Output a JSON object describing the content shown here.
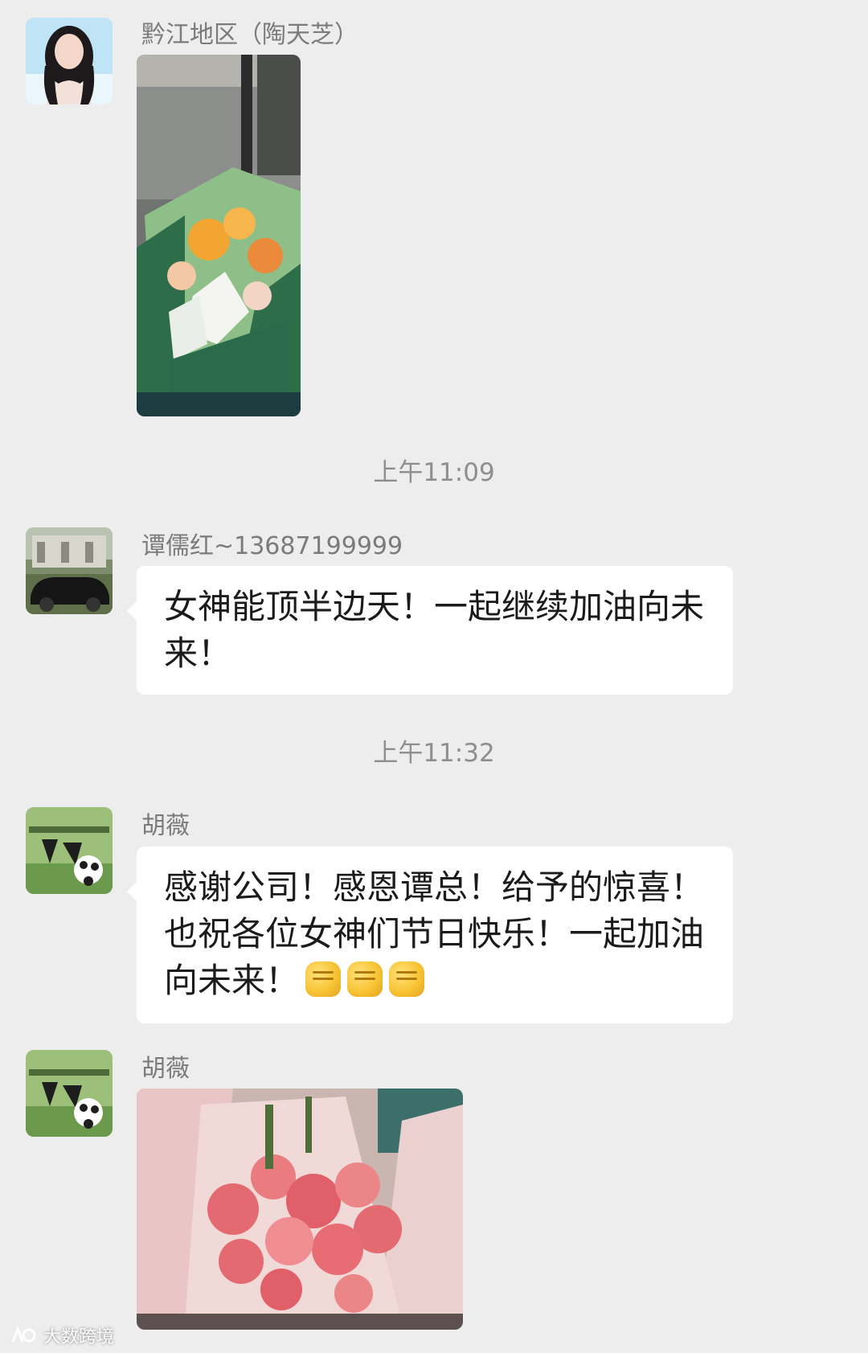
{
  "messages": [
    {
      "sender": "黔江地区（陶天芝）",
      "type": "image",
      "image_desc": "flower-bouquet-yellow-white"
    },
    {
      "time": "上午11:09"
    },
    {
      "sender": "谭儒红~13687199999",
      "text": "女神能顶半边天！一起继续加油向未来！"
    },
    {
      "time": "上午11:32"
    },
    {
      "sender": "胡薇",
      "text": "感谢公司！感恩谭总！给予的惊喜！也祝各位女神们节日快乐！一起加油向未来！",
      "emoji": [
        "fist-emoji",
        "fist-emoji",
        "fist-emoji"
      ]
    },
    {
      "sender": "胡薇",
      "type": "image",
      "image_desc": "flower-bouquet-pink-carnations"
    }
  ],
  "watermark": "大数跨境",
  "colors": {
    "background": "#ededed",
    "bubble": "#ffffff",
    "sender": "#7b7b7b",
    "time": "#8e8e8e"
  }
}
